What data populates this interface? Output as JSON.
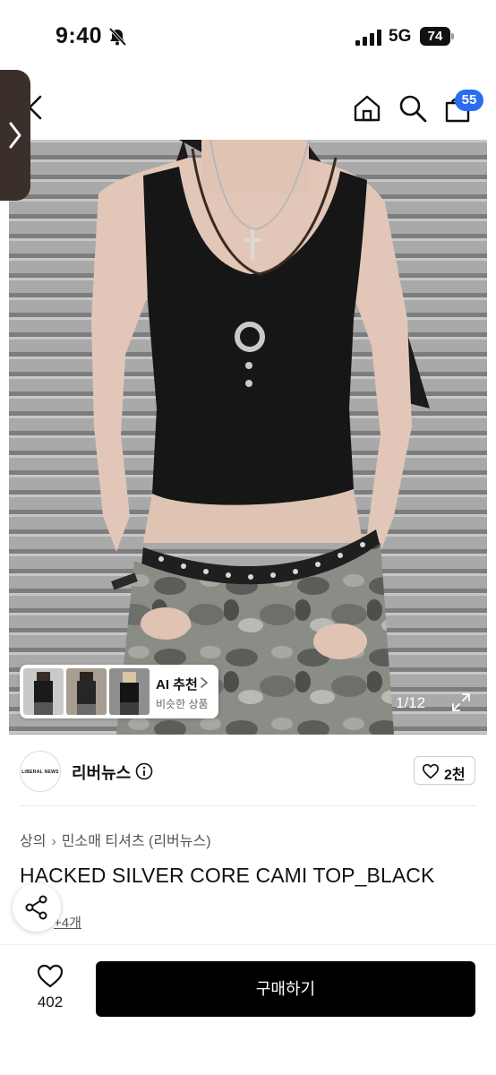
{
  "status_bar": {
    "time": "9:40",
    "network": "5G",
    "battery": "74"
  },
  "header": {
    "cart_count": "55"
  },
  "product_image": {
    "pager": "1/12"
  },
  "ai_recommend": {
    "title": "AI 추천",
    "subtitle": "비슷한 상품"
  },
  "seller": {
    "logo_text": "LIBERAL NEWS",
    "name": "리버뉴스",
    "likes": "2천"
  },
  "breadcrumb": [
    "상의",
    "민소매 티셔츠 (리버뉴스)"
  ],
  "product": {
    "title": "HACKED SILVER CORE CAMI TOP_BLACK",
    "option_link": "+4개"
  },
  "bottom": {
    "wish_count": "402",
    "buy_label": "구매하기"
  },
  "icons": [
    "mute-icon",
    "signal-icon",
    "battery-icon",
    "back-icon",
    "home-icon",
    "search-icon",
    "cart-icon",
    "chevron-right-icon",
    "expand-icon",
    "info-icon",
    "heart-icon",
    "share-icon"
  ],
  "colors": {
    "badge": "#2b6df0",
    "buy_button": "#000000",
    "side_tab": "#3b2f2b"
  }
}
